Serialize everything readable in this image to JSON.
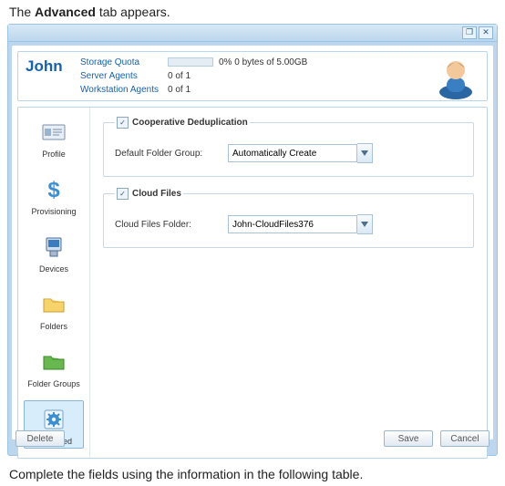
{
  "doc": {
    "intro_prefix": "The ",
    "intro_bold": "Advanced",
    "intro_suffix": " tab appears.",
    "outro": "Complete the fields using the information in the following table."
  },
  "titlebar": {
    "restore_glyph": "❐",
    "close_glyph": "✕"
  },
  "info": {
    "user_name": "John",
    "storage_quota_label": "Storage Quota",
    "storage_quota_value": "0%  0 bytes of 5.00GB",
    "server_agents_label": "Server Agents",
    "server_agents_value": "0 of 1",
    "workstation_agents_label": "Workstation Agents",
    "workstation_agents_value": "0 of 1"
  },
  "sidebar": {
    "items": [
      {
        "label": "Profile",
        "name": "sidebar-item-profile"
      },
      {
        "label": "Provisioning",
        "name": "sidebar-item-provisioning"
      },
      {
        "label": "Devices",
        "name": "sidebar-item-devices"
      },
      {
        "label": "Folders",
        "name": "sidebar-item-folders"
      },
      {
        "label": "Folder Groups",
        "name": "sidebar-item-folder-groups"
      },
      {
        "label": "Advanced",
        "name": "sidebar-item-advanced"
      }
    ]
  },
  "panels": {
    "coop": {
      "check_glyph": "✓",
      "title": "Cooperative Deduplication",
      "folder_group_label": "Default Folder Group:",
      "folder_group_value": "Automatically Create"
    },
    "cloud": {
      "check_glyph": "✓",
      "title": "Cloud Files",
      "folder_label": "Cloud Files Folder:",
      "folder_value": "John-CloudFiles376"
    }
  },
  "footer": {
    "delete": "Delete",
    "save": "Save",
    "cancel": "Cancel"
  }
}
